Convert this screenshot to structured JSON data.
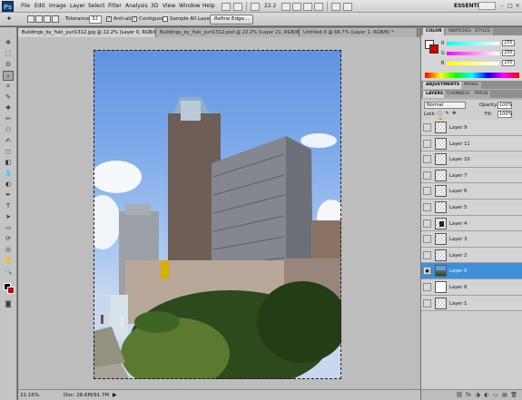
{
  "menubar": {
    "logo": "Ps",
    "items": [
      "File",
      "Edit",
      "Image",
      "Layer",
      "Select",
      "Filter",
      "Analysis",
      "3D",
      "View",
      "Window",
      "Help"
    ],
    "zoom": "22.2",
    "workspace": "ESSENTIALS",
    "window_controls": [
      "–",
      "□",
      "×"
    ]
  },
  "options": {
    "tolerance_label": "Tolerance:",
    "tolerance_value": "32",
    "anti_alias": "Anti-alias",
    "contiguous": "Contiguous",
    "sample_all": "Sample All Layers",
    "refine_edge": "Refine Edge..."
  },
  "tools": [
    "move-tool",
    "marquee-tool",
    "lasso-tool",
    "quick-selection-tool",
    "crop-tool",
    "eyedropper-tool",
    "healing-brush-tool",
    "brush-tool",
    "clone-stamp-tool",
    "history-brush-tool",
    "eraser-tool",
    "gradient-tool",
    "blur-tool",
    "dodge-tool",
    "pen-tool",
    "type-tool",
    "path-selection-tool",
    "shape-tool",
    "3d-rotate-tool",
    "3d-camera-tool",
    "hand-tool",
    "zoom-tool"
  ],
  "tools_glyphs": [
    "✥",
    "⬚",
    "ʘ",
    "⌕",
    "⌗",
    "✎",
    "✚",
    "✏",
    "⚇",
    "✍",
    "◻",
    "◧",
    "💧",
    "◐",
    "✒",
    "T",
    "➤",
    "▭",
    "⟳",
    "◎",
    "✋",
    "🔍"
  ],
  "tabs": [
    "Buildings_by_Yuki_yuri1312.jpg @ 22.2% (Layer 0, RGB/8) *",
    "Buildings_by_Yuki_yuri1312.psd @ 22.2% (Layer 21, RGB/8) *",
    "Untitled-3 @ 66.7% (Layer 1, RGB/8) *"
  ],
  "status": {
    "zoom": "22.16%",
    "doc": "Doc: 28.6M/91.7M",
    "arrow": "▶"
  },
  "color_panel": {
    "tabs": [
      "COLOR",
      "SWATCHES",
      "STYLES"
    ],
    "sliders": [
      {
        "label": "R",
        "value": "255",
        "gradient": "linear-gradient(90deg,#00ffff,#ffffff)"
      },
      {
        "label": "G",
        "value": "255",
        "gradient": "linear-gradient(90deg,#ff00ff,#ffffff)"
      },
      {
        "label": "B",
        "value": "255",
        "gradient": "linear-gradient(90deg,#ffff00,#ffffff)"
      }
    ]
  },
  "adjust_tabs": [
    "ADJUSTMENTS",
    "MASKS"
  ],
  "layers_panel": {
    "tabs": [
      "LAYERS",
      "CHANNELS",
      "PATHS"
    ],
    "blend_mode": "Normal",
    "opacity_label": "Opacity:",
    "opacity_value": "100%",
    "lock_label": "Lock:",
    "lock_icons": "▢ ✎ ✥ 🔒",
    "fill_label": "Fill:",
    "fill_value": "100%",
    "layers": [
      {
        "name": "Layer 9",
        "visible": false,
        "selected": false,
        "thumb": "trans"
      },
      {
        "name": "Layer 11",
        "visible": false,
        "selected": false,
        "thumb": "trans"
      },
      {
        "name": "Layer 10",
        "visible": false,
        "selected": false,
        "thumb": "trans"
      },
      {
        "name": "Layer 7",
        "visible": false,
        "selected": false,
        "thumb": "trans"
      },
      {
        "name": "Layer 6",
        "visible": false,
        "selected": false,
        "thumb": "trans"
      },
      {
        "name": "Layer 5",
        "visible": false,
        "selected": false,
        "thumb": "trans"
      },
      {
        "name": "Layer 4",
        "visible": false,
        "selected": false,
        "thumb": "trans"
      },
      {
        "name": "Layer 3",
        "visible": false,
        "selected": false,
        "thumb": "trans"
      },
      {
        "name": "Layer 2",
        "visible": false,
        "selected": false,
        "thumb": "trans"
      },
      {
        "name": "Layer 0",
        "visible": true,
        "selected": true,
        "thumb": "photo"
      },
      {
        "name": "Layer 8",
        "visible": false,
        "selected": false,
        "thumb": "white"
      },
      {
        "name": "Layer 1",
        "visible": false,
        "selected": false,
        "thumb": "trans"
      }
    ],
    "footer_icons": [
      "⛓",
      "fx",
      "◑",
      "◐",
      "▭",
      "▤",
      "🗑"
    ]
  }
}
